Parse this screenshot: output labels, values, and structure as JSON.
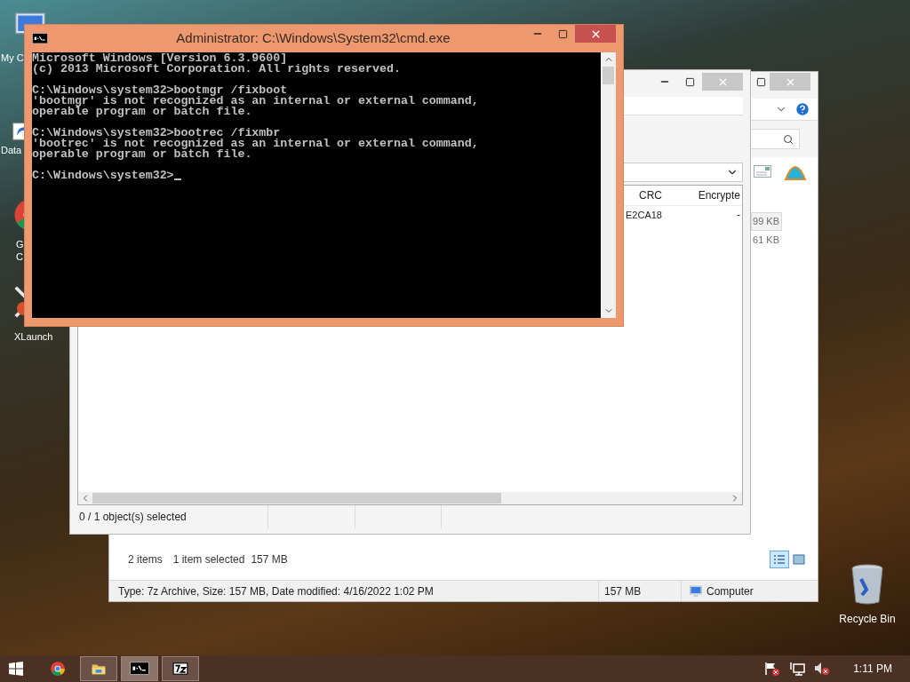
{
  "desktop": {
    "icons": [
      {
        "kind": "computer",
        "lines": [
          "My C"
        ]
      },
      {
        "kind": "shortcut",
        "lines": [
          "Data"
        ]
      },
      {
        "kind": "chrome",
        "lines": [
          "G",
          "C"
        ]
      },
      {
        "kind": "xlaunch",
        "lines": [
          "XLaunch"
        ]
      }
    ],
    "recycle_bin": {
      "label": "Recycle Bin"
    }
  },
  "explorer_window": {
    "rows": [
      {
        "size": "99 KB",
        "selected": true
      },
      {
        "size": "61 KB",
        "selected": false
      }
    ],
    "status": {
      "items": "2 items",
      "selection": "1 item selected",
      "selection_size": "157 MB"
    },
    "views": [
      {
        "kind": "details",
        "selected": true
      },
      {
        "kind": "tiles",
        "selected": false
      }
    ],
    "details_bar": {
      "info": "Type: 7z Archive, Size: 157 MB, Date modified: 4/16/2022 1:02 PM",
      "size": "157 MB",
      "location": "Computer"
    }
  },
  "sevenzip_window": {
    "columns": [
      "CRC",
      "Encrypte"
    ],
    "rows": [
      {
        "cells": [
          "E2CA18",
          "-"
        ]
      }
    ],
    "status": "0 / 1 object(s) selected"
  },
  "cmd_window": {
    "title": "Administrator: C:\\Windows\\System32\\cmd.exe",
    "blocks": [
      [
        "Microsoft Windows [Version 6.3.9600]",
        "(c) 2013 Microsoft Corporation. All rights reserved."
      ],
      [
        "C:\\Windows\\system32>bootmgr /fixboot",
        "'bootmgr' is not recognized as an internal or external command,",
        "operable program or batch file."
      ],
      [
        "C:\\Windows\\system32>bootrec /fixmbr",
        "'bootrec' is not recognized as an internal or external command,",
        "operable program or batch file."
      ]
    ],
    "prompt": "C:\\Windows\\system32>"
  },
  "taskbar": {
    "apps": [
      {
        "kind": "chrome",
        "running": false,
        "selected": false
      },
      {
        "kind": "explorer",
        "running": true,
        "selected": false
      },
      {
        "kind": "cmd",
        "running": true,
        "selected": true
      },
      {
        "kind": "archive",
        "running": true,
        "selected": false
      }
    ],
    "clock": "1:11 PM"
  }
}
